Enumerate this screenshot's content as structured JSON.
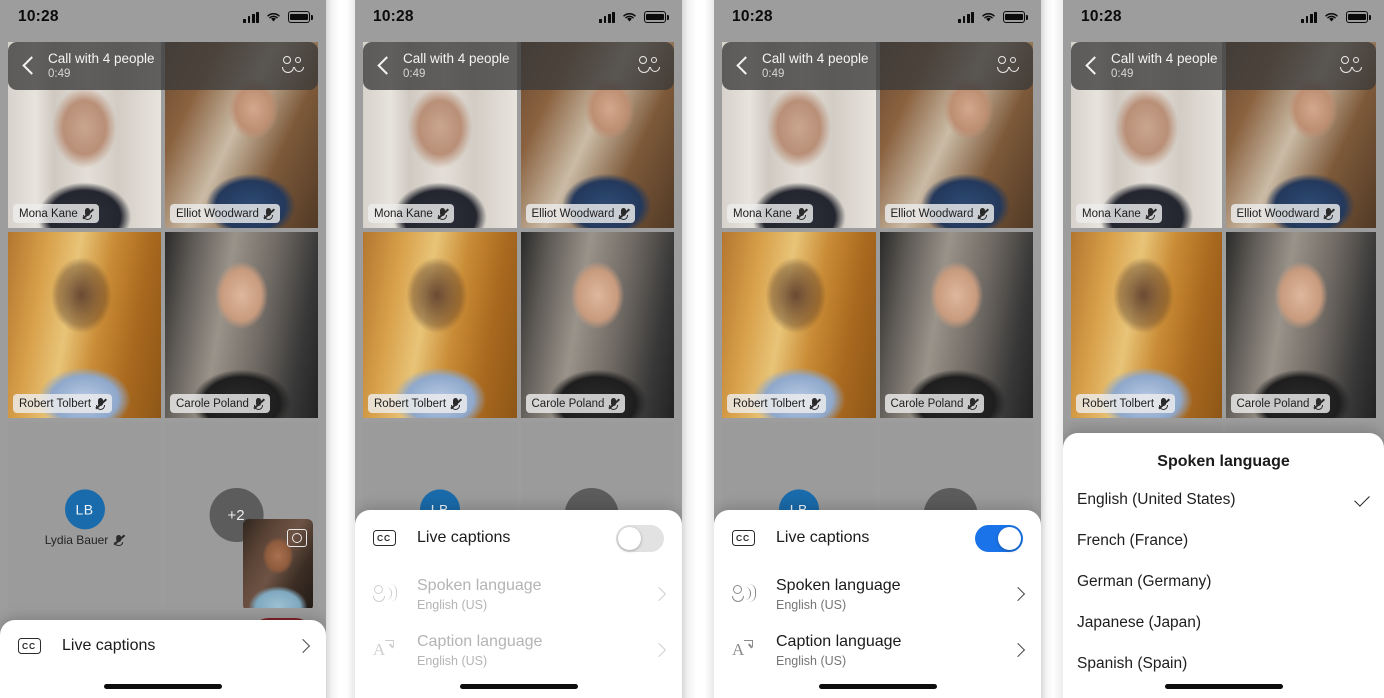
{
  "status_bar": {
    "time": "10:28",
    "signal_icon": "cellular-bars-icon",
    "wifi_icon": "wifi-icon",
    "battery_icon": "battery-full-icon"
  },
  "call_header": {
    "title": "Call with 4 people",
    "duration": "0:49",
    "back_icon": "back-chevron-icon",
    "people_icon": "people-icon"
  },
  "participants": [
    {
      "name": "Mona Kane",
      "muted": true
    },
    {
      "name": "Elliot Woodward",
      "muted": true
    },
    {
      "name": "Robert Tolbert",
      "muted": true
    },
    {
      "name": "Carole Poland",
      "muted": true
    },
    {
      "name": "Lydia Bauer",
      "initials": "LB",
      "muted": true
    }
  ],
  "overflow_badge": "+2",
  "self_view": {
    "flip_camera_icon": "flip-camera-icon"
  },
  "panel1": {
    "sheet": {
      "row": {
        "label": "Live captions",
        "icon": "closed-caption-icon",
        "chevron": "chevron-right-icon"
      }
    }
  },
  "panel2": {
    "sheet": {
      "live_captions": {
        "label": "Live captions",
        "icon": "closed-caption-icon",
        "toggle_state": "off"
      },
      "spoken_language": {
        "label": "Spoken language",
        "value": "English (US)",
        "icon": "speaking-person-icon",
        "chevron": "chevron-right-icon",
        "disabled": true
      },
      "caption_language": {
        "label": "Caption language",
        "value": "English (US)",
        "icon": "translate-icon",
        "chevron": "chevron-right-icon",
        "disabled": true
      }
    }
  },
  "panel3": {
    "sheet": {
      "live_captions": {
        "label": "Live captions",
        "icon": "closed-caption-icon",
        "toggle_state": "on"
      },
      "spoken_language": {
        "label": "Spoken language",
        "value": "English (US)",
        "icon": "speaking-person-icon",
        "chevron": "chevron-right-icon",
        "disabled": false
      },
      "caption_language": {
        "label": "Caption language",
        "value": "English (US)",
        "icon": "translate-icon",
        "chevron": "chevron-right-icon",
        "disabled": false
      }
    }
  },
  "panel4": {
    "sheet": {
      "title": "Spoken language",
      "options": [
        {
          "label": "English (United States)",
          "selected": true
        },
        {
          "label": "French (France)",
          "selected": false
        },
        {
          "label": "German (Germany)",
          "selected": false
        },
        {
          "label": "Japanese (Japan)",
          "selected": false
        },
        {
          "label": "Spanish (Spain)",
          "selected": false
        }
      ],
      "check_icon": "checkmark-icon"
    }
  },
  "colors": {
    "toggle_on": "#1a73e8",
    "toggle_off": "#e2e2e2",
    "avatar": "#1a6bab",
    "end_call_button": "#7e2026",
    "sheet_bg": "#ffffff",
    "call_bg": "#9d9d9d"
  }
}
